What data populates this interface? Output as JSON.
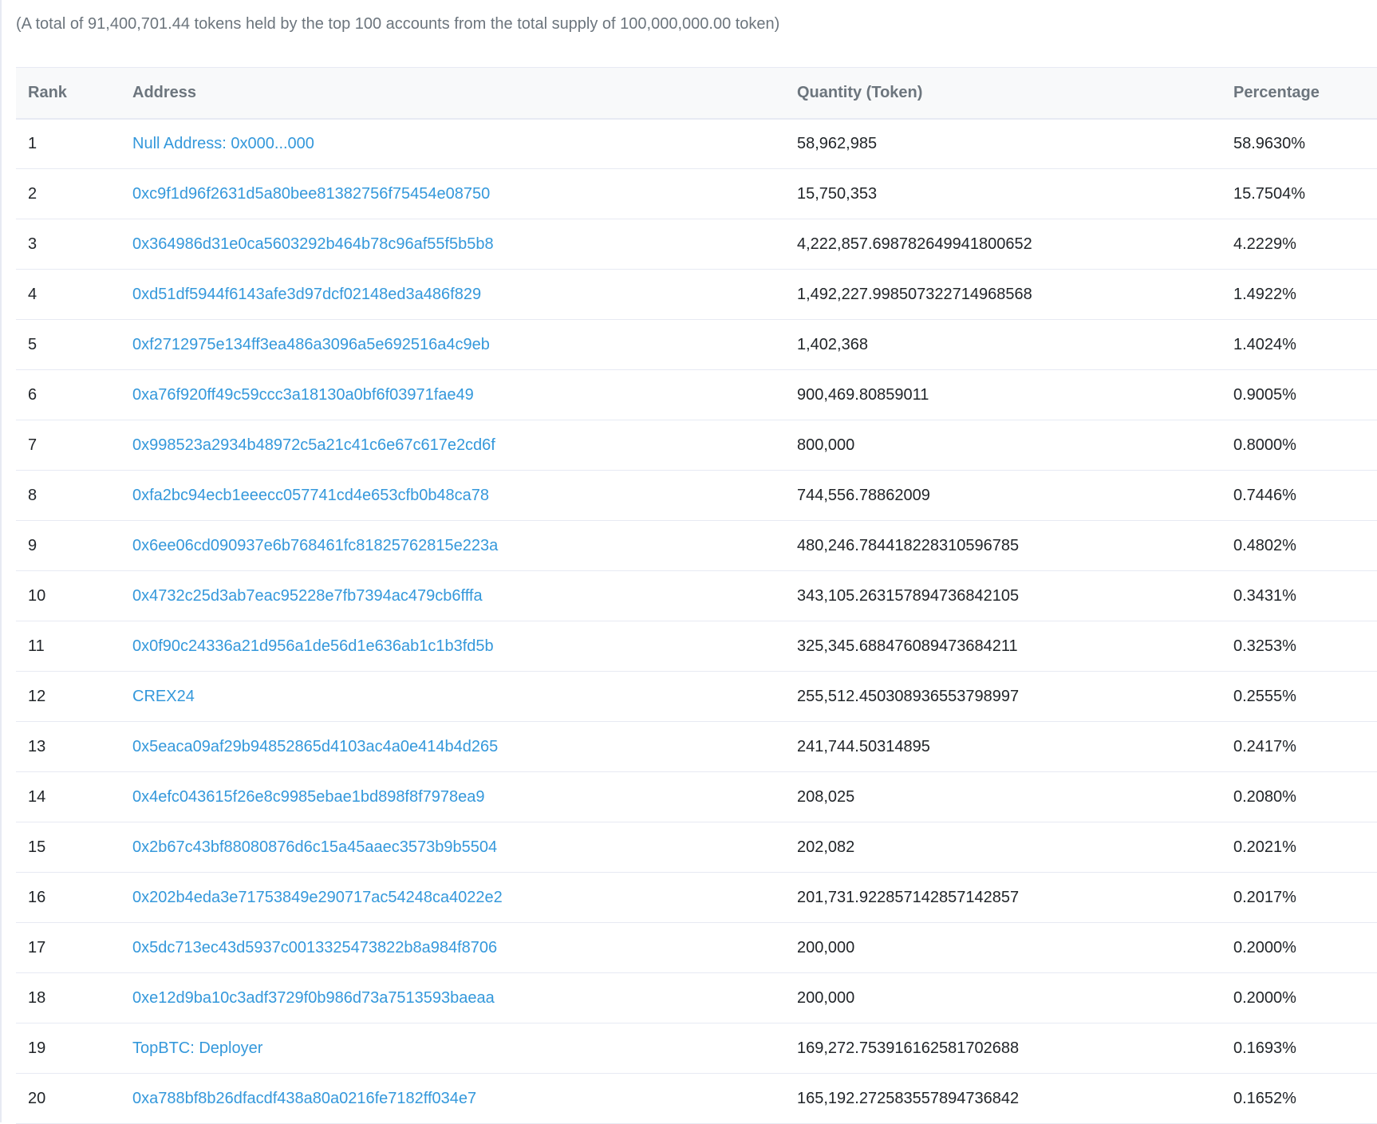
{
  "summary_text": "(A total of 91,400,701.44 tokens held by the top 100 accounts from the total supply of 100,000,000.00 token)",
  "table": {
    "headers": {
      "rank": "Rank",
      "address": "Address",
      "quantity": "Quantity (Token)",
      "percentage": "Percentage"
    },
    "rows": [
      {
        "rank": "1",
        "address": "Null Address: 0x000...000",
        "quantity": "58,962,985",
        "percentage": "58.9630%"
      },
      {
        "rank": "2",
        "address": "0xc9f1d96f2631d5a80bee81382756f75454e08750",
        "quantity": "15,750,353",
        "percentage": "15.7504%"
      },
      {
        "rank": "3",
        "address": "0x364986d31e0ca5603292b464b78c96af55f5b5b8",
        "quantity": "4,222,857.698782649941800652",
        "percentage": "4.2229%"
      },
      {
        "rank": "4",
        "address": "0xd51df5944f6143afe3d97dcf02148ed3a486f829",
        "quantity": "1,492,227.998507322714968568",
        "percentage": "1.4922%"
      },
      {
        "rank": "5",
        "address": "0xf2712975e134ff3ea486a3096a5e692516a4c9eb",
        "quantity": "1,402,368",
        "percentage": "1.4024%"
      },
      {
        "rank": "6",
        "address": "0xa76f920ff49c59ccc3a18130a0bf6f03971fae49",
        "quantity": "900,469.80859011",
        "percentage": "0.9005%"
      },
      {
        "rank": "7",
        "address": "0x998523a2934b48972c5a21c41c6e67c617e2cd6f",
        "quantity": "800,000",
        "percentage": "0.8000%"
      },
      {
        "rank": "8",
        "address": "0xfa2bc94ecb1eeecc057741cd4e653cfb0b48ca78",
        "quantity": "744,556.78862009",
        "percentage": "0.7446%"
      },
      {
        "rank": "9",
        "address": "0x6ee06cd090937e6b768461fc81825762815e223a",
        "quantity": "480,246.784418228310596785",
        "percentage": "0.4802%"
      },
      {
        "rank": "10",
        "address": "0x4732c25d3ab7eac95228e7fb7394ac479cb6fffa",
        "quantity": "343,105.263157894736842105",
        "percentage": "0.3431%"
      },
      {
        "rank": "11",
        "address": "0x0f90c24336a21d956a1de56d1e636ab1c1b3fd5b",
        "quantity": "325,345.688476089473684211",
        "percentage": "0.3253%"
      },
      {
        "rank": "12",
        "address": "CREX24",
        "quantity": "255,512.450308936553798997",
        "percentage": "0.2555%"
      },
      {
        "rank": "13",
        "address": "0x5eaca09af29b94852865d4103ac4a0e414b4d265",
        "quantity": "241,744.50314895",
        "percentage": "0.2417%"
      },
      {
        "rank": "14",
        "address": "0x4efc043615f26e8c9985ebae1bd898f8f7978ea9",
        "quantity": "208,025",
        "percentage": "0.2080%"
      },
      {
        "rank": "15",
        "address": "0x2b67c43bf88080876d6c15a45aaec3573b9b5504",
        "quantity": "202,082",
        "percentage": "0.2021%"
      },
      {
        "rank": "16",
        "address": "0x202b4eda3e71753849e290717ac54248ca4022e2",
        "quantity": "201,731.922857142857142857",
        "percentage": "0.2017%"
      },
      {
        "rank": "17",
        "address": "0x5dc713ec43d5937c0013325473822b8a984f8706",
        "quantity": "200,000",
        "percentage": "0.2000%"
      },
      {
        "rank": "18",
        "address": "0xe12d9ba10c3adf3729f0b986d73a7513593baeaa",
        "quantity": "200,000",
        "percentage": "0.2000%"
      },
      {
        "rank": "19",
        "address": "TopBTC: Deployer",
        "quantity": "169,272.753916162581702688",
        "percentage": "0.1693%"
      },
      {
        "rank": "20",
        "address": "0xa788bf8b26dfacdf438a80a0216fe7182ff034e7",
        "quantity": "165,192.272583557894736842",
        "percentage": "0.1652%"
      }
    ]
  },
  "colors": {
    "link": "#3498db",
    "muted_text": "#6c757d",
    "header_bg": "#f8f9fa",
    "border": "#e7eaf3"
  }
}
